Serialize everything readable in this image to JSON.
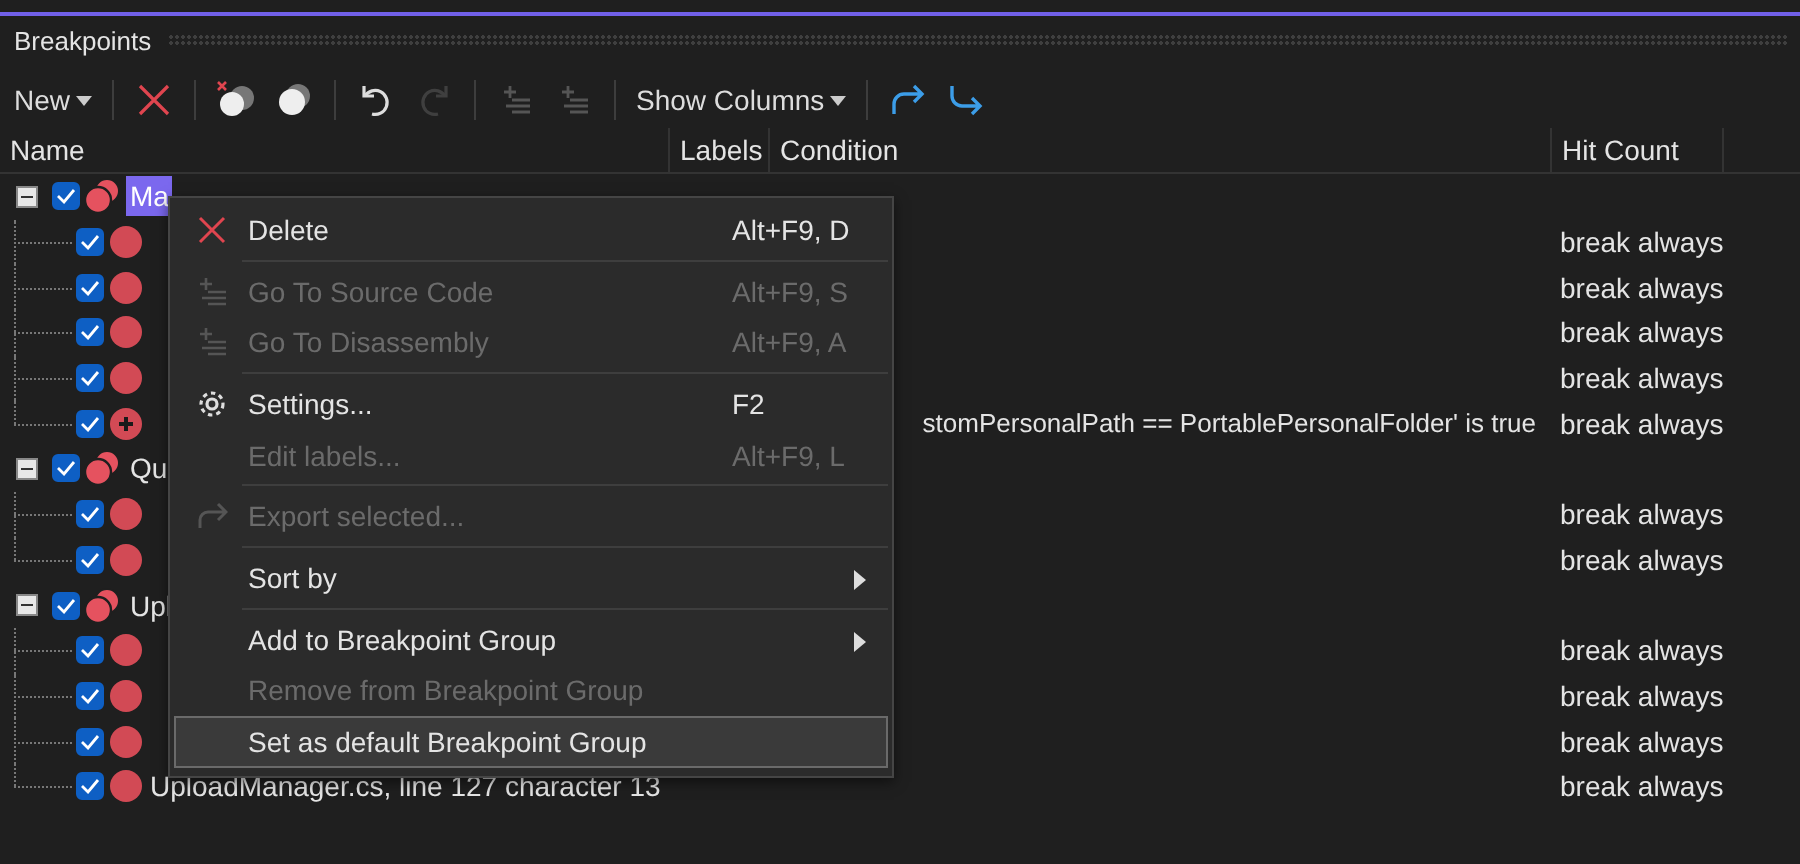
{
  "window": {
    "title": "Breakpoints"
  },
  "toolbar": [
    {
      "kind": "dropdown",
      "label": "New"
    },
    {
      "kind": "separator"
    },
    {
      "kind": "icon"
    },
    {
      "kind": "separator"
    },
    {
      "kind": "icon"
    },
    {
      "kind": "icon"
    },
    {
      "kind": "separator"
    },
    {
      "kind": "icon",
      "disabled": false
    },
    {
      "kind": "icon",
      "disabled": true
    },
    {
      "kind": "separator"
    },
    {
      "kind": "icon",
      "disabled": true
    },
    {
      "kind": "icon",
      "disabled": true
    },
    {
      "kind": "separator"
    },
    {
      "kind": "dropdown",
      "label": "Show Columns"
    },
    {
      "kind": "separator"
    },
    {
      "kind": "icon"
    },
    {
      "kind": "icon"
    }
  ],
  "table": {
    "columns": [
      "Name",
      "Labels",
      "Condition",
      "Hit Count"
    ],
    "groups": [
      {
        "name": "Ma",
        "selected": true,
        "checked": true,
        "expanded": true,
        "children": [
          {
            "kind": "breakpoint",
            "checked": true,
            "hit_count": "break always"
          },
          {
            "kind": "breakpoint",
            "checked": true,
            "hit_count": "break always"
          },
          {
            "kind": "breakpoint",
            "checked": true,
            "hit_count": "break always"
          },
          {
            "kind": "breakpoint",
            "checked": true,
            "hit_count": "break always"
          },
          {
            "kind": "conditional",
            "checked": true,
            "condition": "stomPersonalPath == PortablePersonalFolder' is true",
            "hit_count": "break always"
          }
        ]
      },
      {
        "name": "Qu",
        "selected": false,
        "checked": true,
        "expanded": true,
        "children": [
          {
            "kind": "breakpoint",
            "checked": true,
            "hit_count": "break always"
          },
          {
            "kind": "breakpoint",
            "checked": true,
            "hit_count": "break always"
          }
        ]
      },
      {
        "name": "Upl",
        "selected": false,
        "checked": true,
        "expanded": true,
        "children": [
          {
            "kind": "breakpoint",
            "checked": true,
            "hit_count": "break always"
          },
          {
            "kind": "breakpoint",
            "checked": true,
            "hit_count": "break always"
          },
          {
            "kind": "breakpoint",
            "checked": true,
            "hit_count": "break always"
          },
          {
            "kind": "breakpoint",
            "checked": true,
            "name": "UploadManager.cs, line 127 character 13",
            "hit_count": "break always"
          }
        ]
      }
    ]
  },
  "context_menu": [
    {
      "kind": "item",
      "label": "Delete",
      "shortcut": "Alt+F9, D",
      "disabled": false,
      "selected": false
    },
    {
      "kind": "separator"
    },
    {
      "kind": "item",
      "label": "Go To Source Code",
      "shortcut": "Alt+F9, S",
      "disabled": true,
      "selected": false
    },
    {
      "kind": "item",
      "label": "Go To Disassembly",
      "shortcut": "Alt+F9, A",
      "disabled": true,
      "selected": false
    },
    {
      "kind": "separator"
    },
    {
      "kind": "item",
      "label": "Settings...",
      "shortcut": "F2",
      "disabled": false,
      "selected": false
    },
    {
      "kind": "item",
      "label": "Edit labels...",
      "shortcut": "Alt+F9, L",
      "disabled": true,
      "selected": false
    },
    {
      "kind": "separator"
    },
    {
      "kind": "item",
      "label": "Export selected...",
      "disabled": true,
      "selected": false
    },
    {
      "kind": "separator"
    },
    {
      "kind": "item",
      "label": "Sort by",
      "disabled": false,
      "selected": false,
      "submenu": true
    },
    {
      "kind": "separator"
    },
    {
      "kind": "item",
      "label": "Add to Breakpoint Group",
      "disabled": false,
      "selected": false,
      "submenu": true
    },
    {
      "kind": "item",
      "label": "Remove from Breakpoint Group",
      "disabled": true,
      "selected": false
    },
    {
      "kind": "item",
      "label": "Set as default Breakpoint Group",
      "disabled": false,
      "selected": true
    }
  ]
}
